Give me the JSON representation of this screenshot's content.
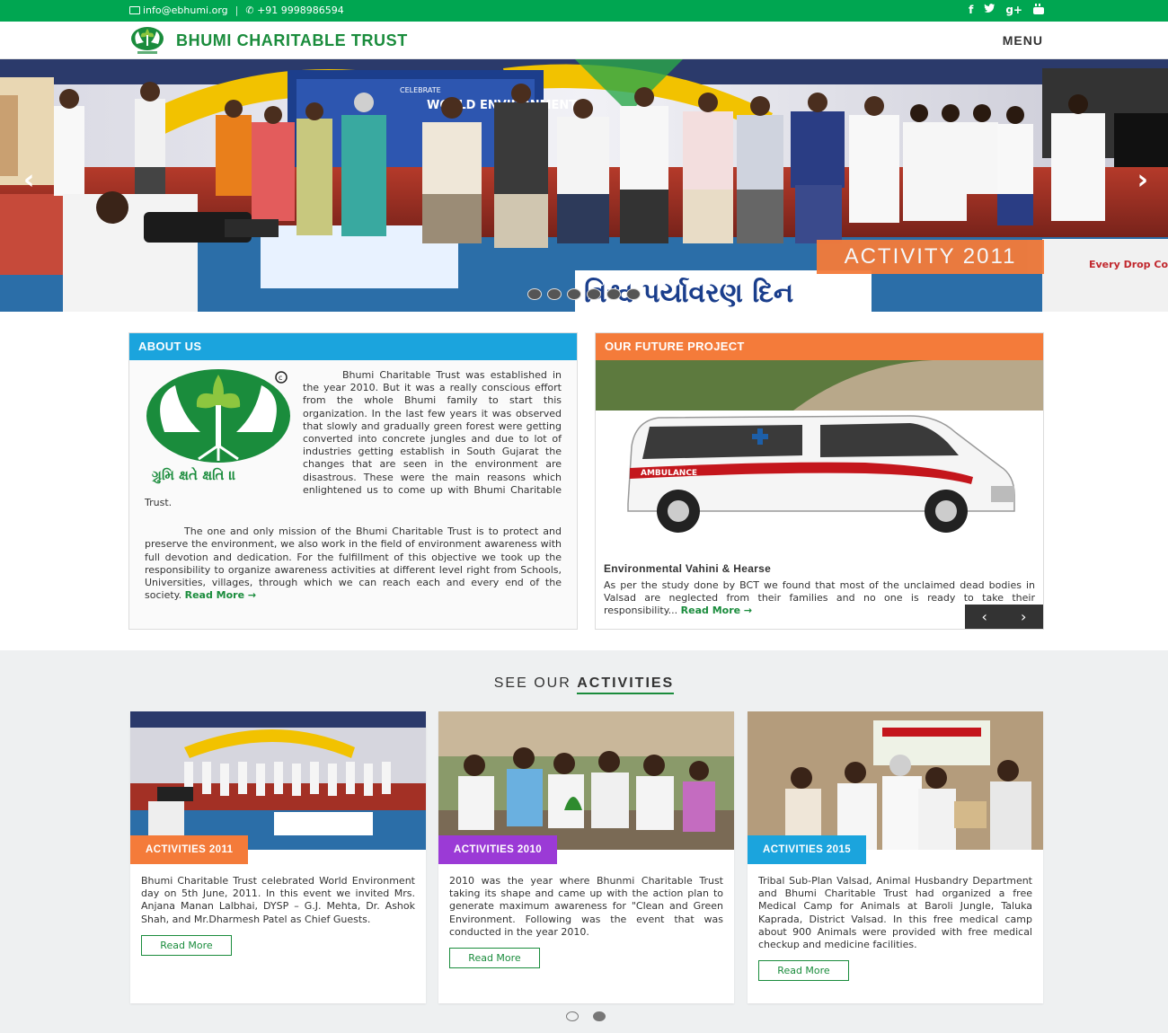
{
  "topbar": {
    "email": "info@ebhumi.org",
    "separator": "|",
    "phone": "+91 9998986594",
    "social": [
      "f",
      "t",
      "g+",
      "yt"
    ]
  },
  "header": {
    "brand": "BHUMI CHARITABLE TRUST",
    "menu_label": "MENU"
  },
  "hero": {
    "caption": "ACTIVITY 2011",
    "prev_icon": "chevron-left-icon",
    "next_icon": "chevron-right-icon",
    "dot_count": 6,
    "banner_text": "WORLD ENVIRONMENT",
    "banner_small": "CELEBRATE",
    "side_text": "Every Drop Counts"
  },
  "about": {
    "heading": "ABOUT US",
    "para1": "Bhumi Charitable Trust was established in the year 2010. But it was a really conscious effort from the whole Bhumi family to start this organization. In the last few years it was observed that slowly and gradually green forest were getting converted into concrete jungles and due to lot of industries getting establish in South Gujarat the changes that are seen in the environment are disastrous. These were the main reasons which enlightened us to come up with Bhumi Charitable Trust.",
    "para2": "The one and only mission of the Bhumi Charitable Trust is to protect and preserve the environment, we also work in the field of environment awareness with full devotion and dedication. For the fulfillment of this objective we took up the responsibility to organize awareness activities at different level right from Schools, Universities, villages, through which we can reach each and every end of the society.",
    "read_more": "Read More →"
  },
  "project": {
    "heading": "OUR FUTURE PROJECT",
    "title": "Environmental Vahini & Hearse",
    "text": "As per the study done by BCT we found that most of the unclaimed dead bodies in Valsad are neglected from their families and no one is ready to take their responsibility...",
    "read_more": "Read More →",
    "ambulance_label": "AMBULANCE"
  },
  "activities": {
    "heading_light": "SEE OUR ",
    "heading_bold": "ACTIVITIES",
    "cards": [
      {
        "tag": "ACTIVITIES 2011",
        "color": "#f47b3a",
        "text": "Bhumi Charitable Trust celebrated World Environment day on 5th June, 2011. In this event we invited Mrs. Anjana Manan Lalbhai, DYSP – G.J. Mehta, Dr. Ashok Shah, and Mr.Dharmesh Patel as Chief Guests.",
        "button": "Read More"
      },
      {
        "tag": "ACTIVITIES 2010",
        "color": "#9b3ad6",
        "text": "2010 was the year where Bhunmi Charitable Trust taking its shape and came up with the action plan to generate maximum awareness for \"Clean and Green Environment. Following was the event that was conducted in the year 2010.",
        "button": "Read More"
      },
      {
        "tag": "ACTIVITIES 2015",
        "color": "#1ba4dd",
        "text": "Tribal Sub-Plan Valsad, Animal Husbandry Department and Bhumi Charitable Trust had organized a free Medical Camp for Animals at Baroli Jungle, Taluka Kaprada, District Valsad. In this free medical camp about 900 Animals were provided with free medical checkup and medicine facilities.",
        "button": "Read More"
      }
    ],
    "page_dots": 2,
    "active_dot": 2
  },
  "colors": {
    "green": "#00a651",
    "brand_green": "#1a8c3c",
    "orange": "#f47b3a",
    "blue": "#1ba4dd",
    "purple": "#9b3ad6"
  }
}
